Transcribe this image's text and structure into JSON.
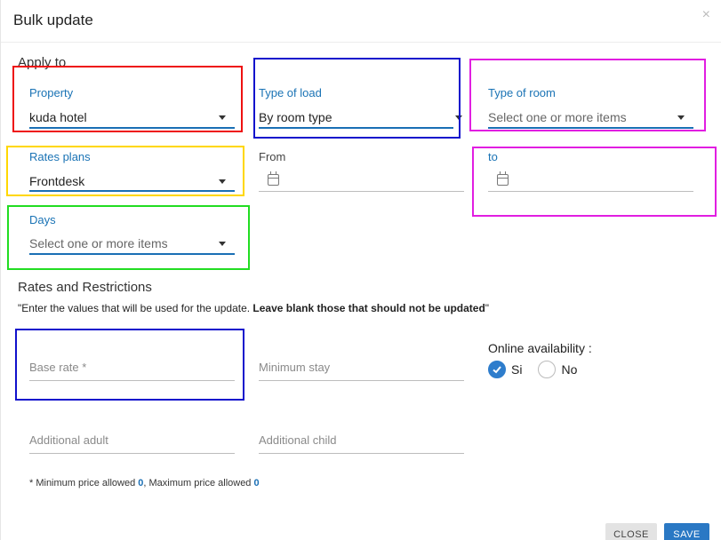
{
  "dialog": {
    "title": "Bulk update",
    "close_icon": "×"
  },
  "apply_to": {
    "heading": "Apply to",
    "property": {
      "label": "Property",
      "value": "kuda hotel"
    },
    "type_of_load": {
      "label": "Type of load",
      "value": "By room type"
    },
    "type_of_room": {
      "label": "Type of room",
      "placeholder": "Select one or more items"
    },
    "rate_plans": {
      "label": "Rates plans",
      "value": "Frontdesk"
    },
    "from": {
      "label": "From",
      "value": ""
    },
    "to": {
      "label": "to",
      "value": ""
    },
    "days": {
      "label": "Days",
      "placeholder": "Select one or more items"
    }
  },
  "rates": {
    "heading": "Rates and Restrictions",
    "note_prefix": "\"Enter the values that will be used for the update. ",
    "note_bold": "Leave blank those that should not be updated",
    "note_suffix": "\"",
    "base_rate": {
      "placeholder": "Base rate *"
    },
    "minimum_stay": {
      "placeholder": "Minimum stay"
    },
    "additional_adult": {
      "placeholder": "Additional adult"
    },
    "additional_child": {
      "placeholder": "Additional child"
    },
    "online_availability": {
      "label": "Online availability :",
      "options": [
        {
          "label": "Si",
          "checked": true
        },
        {
          "label": "No",
          "checked": false
        }
      ]
    },
    "footnote": {
      "min_text": "* Minimum price allowed ",
      "min_value": "0",
      "max_text": ", Maximum price allowed ",
      "max_value": "0"
    }
  },
  "footer": {
    "close_label": "CLOSE",
    "save_label": "SAVE"
  },
  "colors": {
    "accent": "#1a6fb5",
    "highlight_red": "#ee1111",
    "highlight_blue": "#1111cc",
    "highlight_magenta": "#e11ee1",
    "highlight_yellow": "#ffd700",
    "highlight_green": "#22dd22"
  }
}
